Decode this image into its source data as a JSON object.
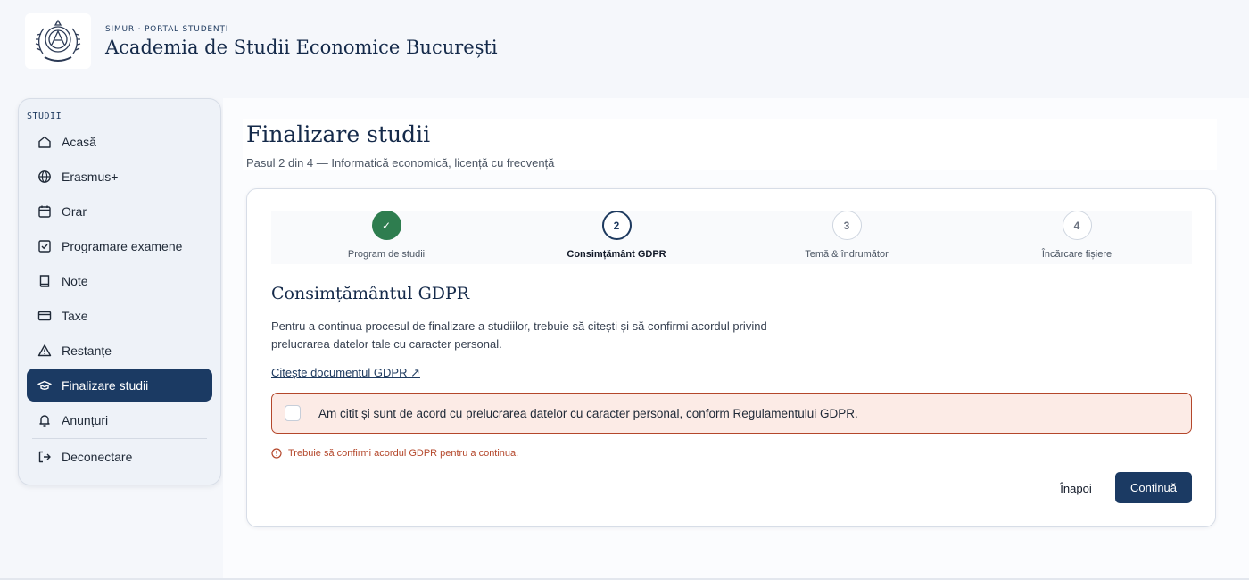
{
  "header": {
    "eyebrow": "SIMUR · PORTAL STUDENȚI",
    "institution": "Academia de Studii Economice București"
  },
  "sidebar": {
    "section_label": "STUDII",
    "items": [
      {
        "label": "Acasă",
        "icon": "home-icon"
      },
      {
        "label": "Erasmus+",
        "icon": "globe-icon"
      },
      {
        "label": "Orar",
        "icon": "calendar-icon"
      },
      {
        "label": "Programare examene",
        "icon": "calendar-check-icon"
      },
      {
        "label": "Note",
        "icon": "book-icon"
      },
      {
        "label": "Taxe",
        "icon": "credit-card-icon"
      },
      {
        "label": "Restanțe",
        "icon": "warning-icon"
      },
      {
        "label": "Finalizare studii",
        "icon": "graduation-cap-icon",
        "active": true
      },
      {
        "label": "Anunțuri",
        "icon": "bell-icon"
      },
      {
        "label": "Deconectare",
        "icon": "logout-icon"
      }
    ]
  },
  "page": {
    "title": "Finalizare studii",
    "subtitle": "Pasul 2 din 4 — Informatică economică, licență cu frecvență"
  },
  "stepper": {
    "steps": [
      {
        "number": "✓",
        "label": "Program de studii",
        "state": "done"
      },
      {
        "number": "2",
        "label": "Consimțământ GDPR",
        "state": "current"
      },
      {
        "number": "3",
        "label": "Temă & îndrumător",
        "state": "todo"
      },
      {
        "number": "4",
        "label": "Încărcare fișiere",
        "state": "todo"
      }
    ]
  },
  "gdpr": {
    "title": "Consimțământul GDPR",
    "description": "Pentru a continua procesul de finalizare a studiilor, trebuie să citești și să confirmi acordul privind prelucrarea datelor tale cu caracter personal.",
    "link": "Citește documentul GDPR ↗",
    "consent_label": "Am citit și sunt de acord cu prelucrarea datelor cu caracter personal, conform Regulamentului GDPR.",
    "consent_checked": false,
    "error": "Trebuie să confirmi acordul GDPR pentru a continua."
  },
  "actions": {
    "back": "Înapoi",
    "continue": "Continuă"
  },
  "colors": {
    "primary": "#1b3a63",
    "success": "#2e7d4f",
    "error": "#b4472b",
    "error_bg": "#fcebe6"
  }
}
